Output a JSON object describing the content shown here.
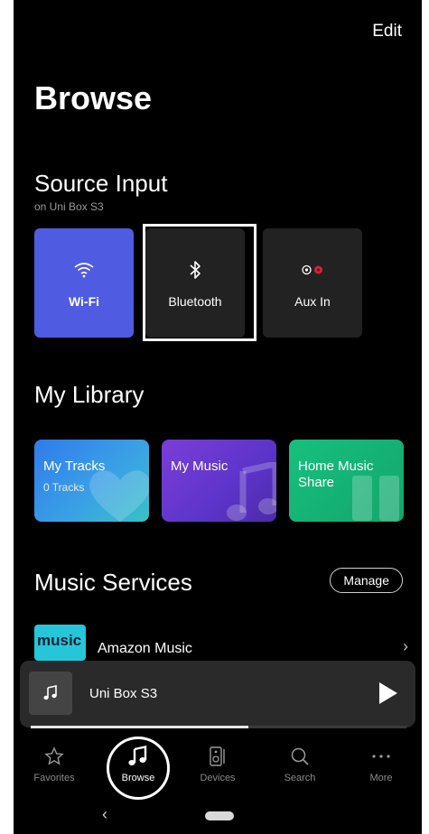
{
  "header": {
    "edit_label": "Edit",
    "page_title": "Browse"
  },
  "source_input": {
    "title": "Source Input",
    "subtitle": "on Uni Box S3",
    "tiles": [
      {
        "label": "Wi-Fi",
        "icon": "wifi-icon",
        "color": "#4f5be0"
      },
      {
        "label": "Bluetooth",
        "icon": "bluetooth-icon",
        "selected": true
      },
      {
        "label": "Aux In",
        "icon": "aux-icon"
      }
    ]
  },
  "library": {
    "title": "My Library",
    "tiles": [
      {
        "label": "My Tracks",
        "sub": "0 Tracks",
        "icon": "heart-icon"
      },
      {
        "label": "My Music",
        "icon": "music-note-icon"
      },
      {
        "label": "Home Music Share",
        "icon": "speaker-icon"
      }
    ]
  },
  "services": {
    "title": "Music Services",
    "manage_label": "Manage",
    "items": [
      {
        "name": "Amazon Music",
        "logo_text": "music",
        "logo_color": "#26c6d9"
      }
    ]
  },
  "player": {
    "device_name": "Uni Box S3",
    "progress": 0.58
  },
  "nav": {
    "items": [
      {
        "label": "Favorites",
        "icon": "star-icon"
      },
      {
        "label": "Browse",
        "icon": "music-note-icon",
        "active": true
      },
      {
        "label": "Devices",
        "icon": "speaker-icon"
      },
      {
        "label": "Search",
        "icon": "search-icon"
      },
      {
        "label": "More",
        "icon": "more-icon"
      }
    ]
  }
}
